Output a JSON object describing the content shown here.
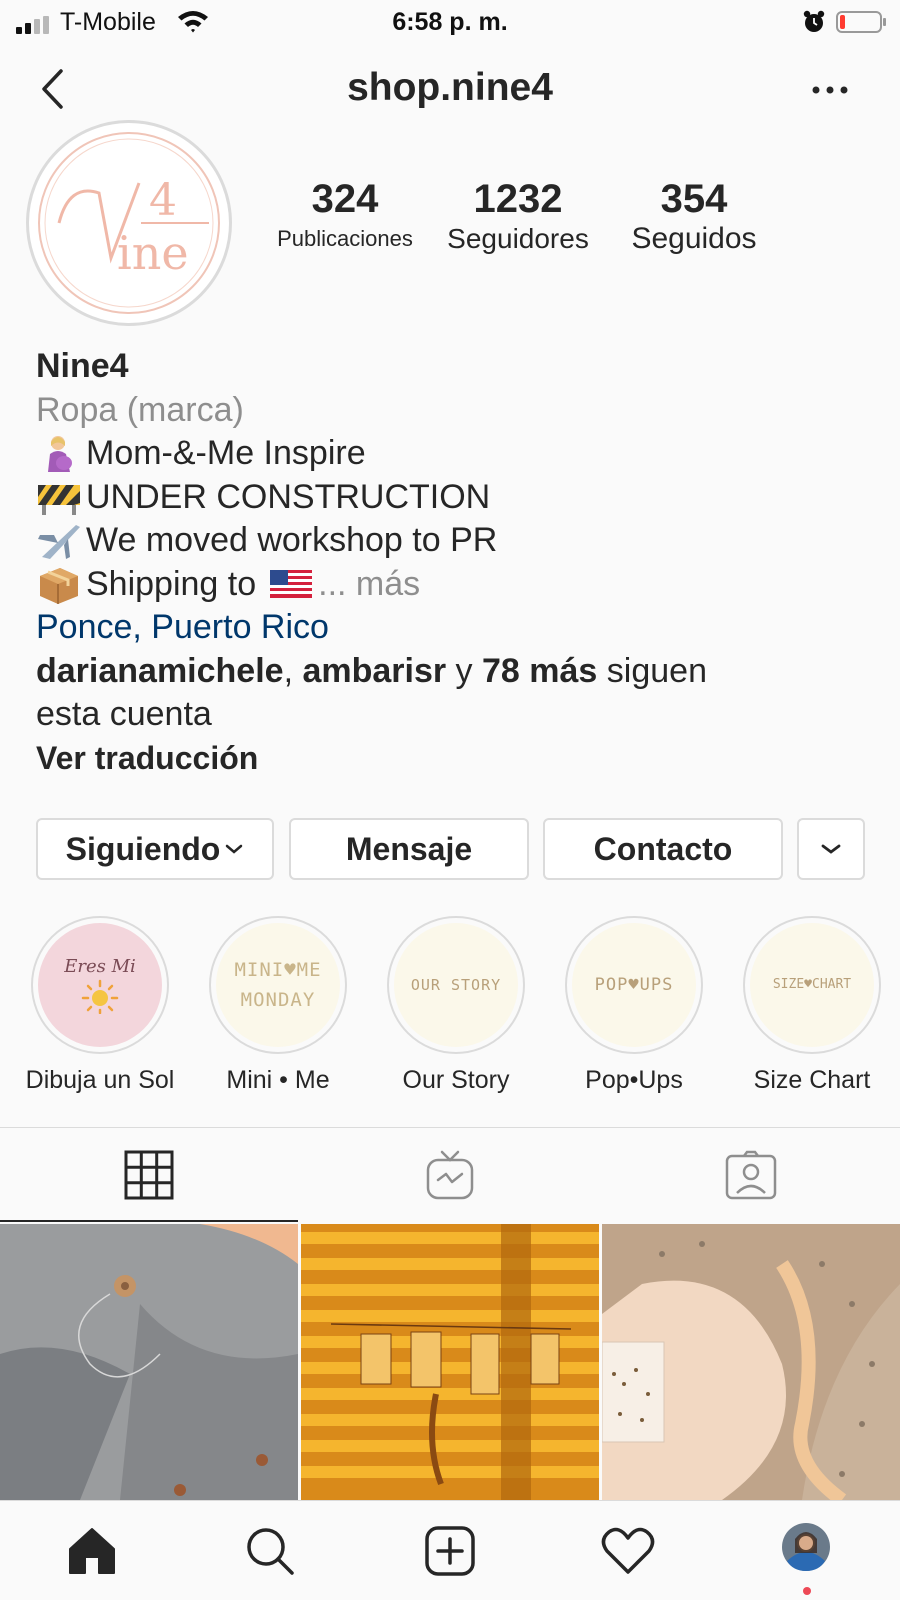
{
  "status_bar": {
    "carrier": "T-Mobile",
    "time": "6:58 p. m."
  },
  "nav": {
    "title": "shop.nine4"
  },
  "profile": {
    "avatar_logo": "Nine 4",
    "stats": [
      {
        "value": "324",
        "label": "Publicaciones"
      },
      {
        "value": "1232",
        "label": "Seguidores"
      },
      {
        "value": "354",
        "label": "Seguidos"
      }
    ],
    "name": "Nine4",
    "category": "Ropa (marca)",
    "bio_lines": [
      "Mom-&-Me Inspire",
      "UNDER CONSTRUCTION",
      "We moved workshop to PR",
      "Shipping to"
    ],
    "more": "... más",
    "location": "Ponce, Puerto Rico",
    "followed_by": {
      "user1": "darianamichele",
      "sep": ", ",
      "user2": "ambarisr",
      "and": " y ",
      "others": "78 más",
      "suffix_line1": " siguen",
      "suffix_line2": "esta cuenta"
    },
    "translate": "Ver traducción"
  },
  "buttons": {
    "following": "Siguiendo",
    "message": "Mensaje",
    "contact": "Contacto"
  },
  "highlights": [
    {
      "label": "Dibuja un Sol",
      "cover_text": "Eres Mi",
      "bg": "#f3d6dc"
    },
    {
      "label": "Mini • Me",
      "cover_text_1": "MINI♥ME",
      "cover_text_2": "MONDAY",
      "bg": "#fbf8ea"
    },
    {
      "label": "Our Story",
      "cover_text": "OUR STORY",
      "bg": "#fbf8ea"
    },
    {
      "label": "Pop•Ups",
      "cover_text": "POP♥UPS",
      "bg": "#fbf8ea"
    },
    {
      "label": "Size Chart",
      "cover_text": "SIZE♥CHART",
      "bg": "#fbf8ea"
    }
  ],
  "icons": {
    "tab_grid": "grid-icon",
    "tab_igtv": "igtv-icon",
    "tab_tagged": "tagged-icon",
    "home": "home-icon",
    "search": "search-icon",
    "new_post": "add-post-icon",
    "activity": "heart-icon",
    "profile": "profile-avatar"
  },
  "colors": {
    "link": "#00376b",
    "secondary_text": "#8e8e8e",
    "border": "#dbdbdb",
    "notification_dot": "#ed4956"
  }
}
